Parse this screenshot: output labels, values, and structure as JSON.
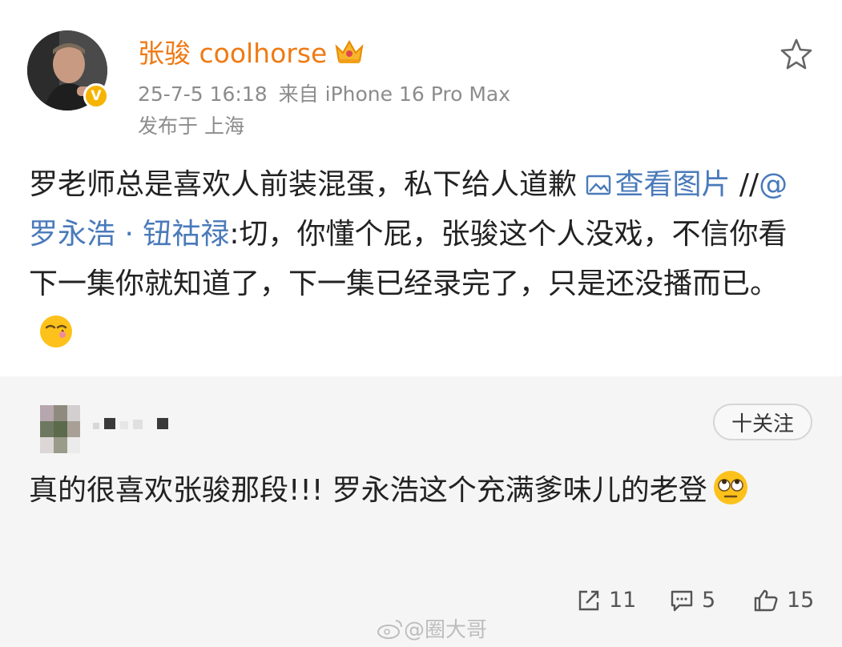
{
  "post": {
    "author": "张骏 coolhorse",
    "timestamp": "25-7-5 16:18",
    "source": "来自 iPhone 16 Pro Max",
    "location": "发布于 上海",
    "text_part1": "罗老师总是喜欢人前装混蛋，私下给人道歉 ",
    "view_image_link": "查看图片",
    "repost_prefix": " //",
    "mention": "@罗永浩 · 钮祜禄",
    "text_part2": ":切，你懂个屁，张骏这个人没戏，不信你看下一集你就知道了，下一集已经录完了，只是还没播而已。",
    "verified_icon": "verified-v-icon",
    "author_badge_icon": "crown-icon",
    "favorite_icon": "star-outline-icon",
    "accent_color": "#ef7a14",
    "link_color": "#4a7aba"
  },
  "comment": {
    "follow_label": "十关注",
    "text": "真的很喜欢张骏那段!!! 罗永浩这个充满爹味儿的老登"
  },
  "actions": {
    "repost_count": "11",
    "comment_count": "5",
    "like_count": "15"
  },
  "watermark": {
    "text": "@圈大哥",
    "logo_icon": "weibo-logo-icon"
  }
}
